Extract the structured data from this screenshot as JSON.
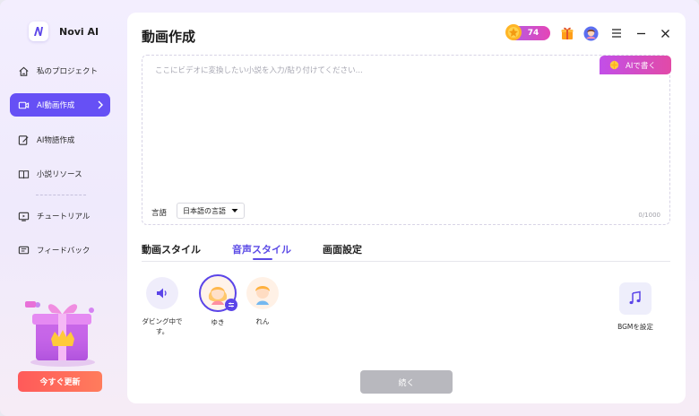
{
  "app": {
    "name": "Novi AI",
    "accent": "#6650f5"
  },
  "sidebar": {
    "items": [
      {
        "label": "私のプロジェクト",
        "icon": "home-icon"
      },
      {
        "label": "AI動画作成",
        "icon": "video-icon",
        "active": true
      },
      {
        "label": "AI物語作成",
        "icon": "edit-icon"
      },
      {
        "label": "小説リソース",
        "icon": "book-icon"
      },
      {
        "label": "チュートリアル",
        "icon": "tutorial-icon"
      },
      {
        "label": "フィードバック",
        "icon": "feedback-icon"
      }
    ],
    "upgrade_label": "今すぐ更新"
  },
  "header": {
    "title": "動画作成",
    "coins": "74"
  },
  "editor": {
    "placeholder": "ここにビデオに変換したい小説を入力/貼り付けてください...",
    "ai_write_label": "AIで書く",
    "language_label": "言語",
    "language_value": "日本語の言語",
    "char_count": "0/1000"
  },
  "tabs": [
    {
      "label": "動画スタイル",
      "active": false
    },
    {
      "label": "音声スタイル",
      "active": true
    },
    {
      "label": "画面設定",
      "active": false
    }
  ],
  "voices": [
    {
      "label": "ダビング中です。",
      "icon": "speaker-icon"
    },
    {
      "label": "ゆき",
      "icon": "avatar-girl-icon",
      "selected": true
    },
    {
      "label": "れん",
      "icon": "avatar-boy-icon"
    }
  ],
  "bgm": {
    "label": "BGMを設定",
    "icon": "music-icon"
  },
  "continue_label": "続く"
}
